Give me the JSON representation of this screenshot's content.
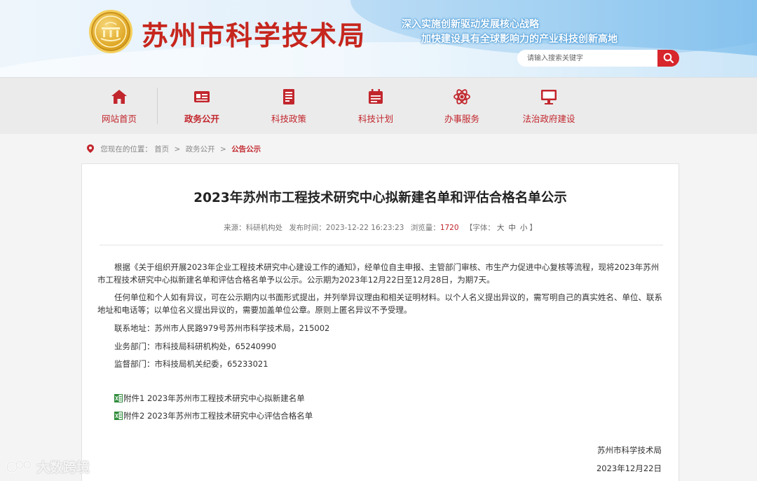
{
  "header": {
    "site_title": "苏州市科学技术局",
    "slogan_line1": "深入实施创新驱动发展核心战略",
    "slogan_line2": "加快建设具有全球影响力的产业科技创新高地",
    "search_placeholder": "请输入搜索关键字",
    "search_button_icon": "search-icon"
  },
  "nav": {
    "items": [
      {
        "label": "网站首页",
        "icon": "home-icon",
        "active": false
      },
      {
        "label": "政务公开",
        "icon": "id-card-icon",
        "active": true
      },
      {
        "label": "科技政策",
        "icon": "document-icon",
        "active": false
      },
      {
        "label": "科技计划",
        "icon": "calendar-icon",
        "active": false
      },
      {
        "label": "办事服务",
        "icon": "atom-icon",
        "active": false
      },
      {
        "label": "法治政府建设",
        "icon": "monitor-icon",
        "active": false
      }
    ]
  },
  "breadcrumb": {
    "prefix": "您现在的位置：",
    "items": [
      "首页",
      "政务公开"
    ],
    "current": "公告公示",
    "separator": ">"
  },
  "article": {
    "title": "2023年苏州市工程技术研究中心拟新建名单和评估合格名单公示",
    "meta": {
      "source": "来源：科研机构处",
      "publish_time": "发布时间：2023-12-22 16:23:23",
      "views_label": "浏览量：",
      "views": "1720",
      "font_size_prefix": "【字体：",
      "font_large": "大",
      "font_medium": "中",
      "font_small": "小",
      "font_size_suffix": "】"
    },
    "paragraph1": "根据《关于组织开展2023年企业工程技术研究中心建设工作的通知》，经单位自主申报、主管部门审核、市生产力促进中心复核等流程，现将2023年苏州市工程技术研究中心拟新建名单和评估合格名单予以公示。公示期为2023年12月22日至12月28日，为期7天。",
    "paragraph2": "任何单位和个人如有异议，可在公示期内以书面形式提出，并列举异议理由和相关证明材料。以个人名义提出异议的，需写明自己的真实姓名、单位、联系地址和电话等；以单位名义提出异议的，需要加盖单位公章。原则上匿名异议不予受理。",
    "contact_address": "联系地址：苏州市人民路979号苏州市科学技术局，215002",
    "business_dept": "业务部门：市科技局科研机构处，65240990",
    "supervision_dept": "监督部门：市科技局机关纪委，65233021",
    "attachments": [
      {
        "label": "附件1 2023年苏州市工程技术研究中心拟新建名单",
        "icon": "excel-file-icon"
      },
      {
        "label": "附件2 2023年苏州市工程技术研究中心评估合格名单",
        "icon": "excel-file-icon"
      }
    ],
    "signature": "苏州市科学技术局",
    "date": "2023年12月22日"
  },
  "watermark": {
    "text": "大数跨境"
  },
  "colors": {
    "brand_red": "#c2262d",
    "search_red": "#d7262c",
    "nav_bg": "#ebebeb"
  }
}
